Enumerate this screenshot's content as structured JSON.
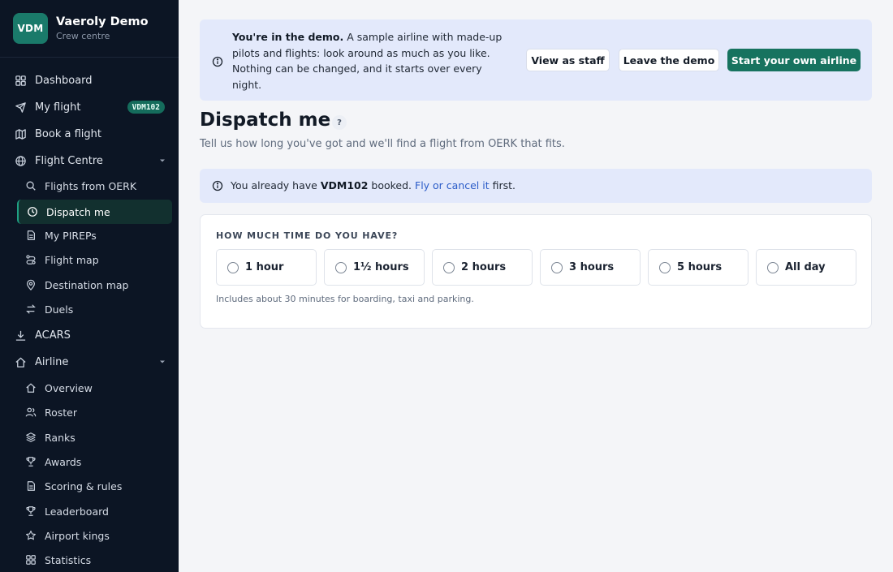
{
  "brand": {
    "logo": "VDM",
    "name": "Vaeroly Demo",
    "subtitle": "Crew centre"
  },
  "sidebar": {
    "top1": [
      {
        "label": "Dashboard",
        "icon": "dashboard-icon"
      },
      {
        "label": "My flight",
        "icon": "plane-icon",
        "badge": "VDM102"
      },
      {
        "label": "Book a flight",
        "icon": "map-icon"
      },
      {
        "label": "Flight Centre",
        "icon": "globe-icon",
        "expanded": true
      }
    ],
    "flight_centre": [
      {
        "label": "Flights from OERK",
        "icon": "search-icon"
      },
      {
        "label": "Dispatch me",
        "icon": "clock-icon",
        "active": true
      },
      {
        "label": "My PIREPs",
        "icon": "document-icon"
      },
      {
        "label": "Flight map",
        "icon": "route-icon"
      },
      {
        "label": "Destination map",
        "icon": "pin-icon"
      },
      {
        "label": "Duels",
        "icon": "swap-icon"
      }
    ],
    "top2": [
      {
        "label": "ACARS",
        "icon": "download-icon"
      },
      {
        "label": "Airline",
        "icon": "home-icon",
        "expanded": true
      }
    ],
    "airline": [
      {
        "label": "Overview",
        "icon": "home-icon"
      },
      {
        "label": "Roster",
        "icon": "users-icon"
      },
      {
        "label": "Ranks",
        "icon": "layers-icon"
      },
      {
        "label": "Awards",
        "icon": "trophy-icon"
      },
      {
        "label": "Scoring & rules",
        "icon": "document-icon"
      },
      {
        "label": "Leaderboard",
        "icon": "trophy-icon"
      },
      {
        "label": "Airport kings",
        "icon": "star-icon"
      },
      {
        "label": "Statistics",
        "icon": "grid-icon"
      }
    ]
  },
  "banner": {
    "bold": "You're in the demo.",
    "text": " A sample airline with made-up pilots and flights: look around as much as you like. Nothing can be changed, and it starts over every night.",
    "view_staff": "View as staff",
    "leave": "Leave the demo",
    "start": "Start your own airline"
  },
  "page": {
    "title": "Dispatch me",
    "help": "?",
    "subtitle": "Tell us how long you've got and we'll find a flight from OERK that fits."
  },
  "notice": {
    "pre": "You already have ",
    "flight": "VDM102",
    "mid": " booked. ",
    "link": "Fly or cancel it",
    "post": " first."
  },
  "time_card": {
    "heading": "HOW MUCH TIME DO YOU HAVE?",
    "options": [
      "1 hour",
      "1½ hours",
      "2 hours",
      "3 hours",
      "5 hours",
      "All day"
    ],
    "footnote": "Includes about 30 minutes for boarding, taxi and parking."
  },
  "colors": {
    "sidebar_bg": "#0c1524",
    "accent": "#17735f",
    "banner_bg": "#e3e9fb",
    "link": "#2b5cc8"
  }
}
